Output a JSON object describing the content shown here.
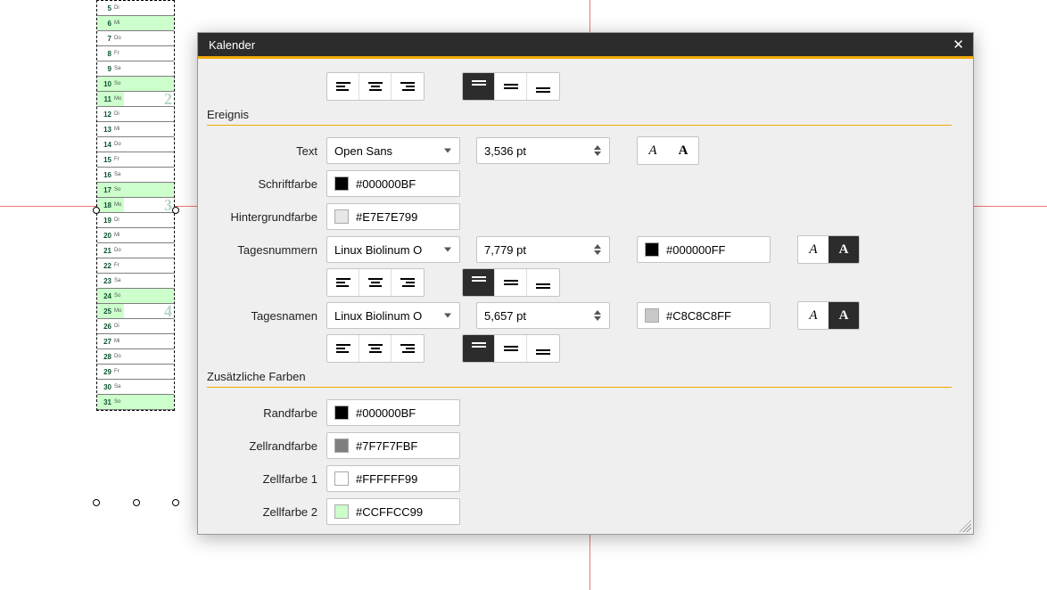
{
  "dialog": {
    "title": "Kalender"
  },
  "sections": {
    "ereignis": "Ereignis",
    "zusatz": "Zusätzliche Farben"
  },
  "labels": {
    "text": "Text",
    "schriftfarbe": "Schriftfarbe",
    "hintergrundfarbe": "Hintergrundfarbe",
    "tagesnummern": "Tagesnummern",
    "tagesnamen": "Tagesnamen",
    "randfarbe": "Randfarbe",
    "zellrandfarbe": "Zellrandfarbe",
    "zellfarbe1": "Zellfarbe 1",
    "zellfarbe2": "Zellfarbe 2"
  },
  "values": {
    "textFont": "Open Sans",
    "textSize": "3,536 pt",
    "schriftfarbe": "#000000BF",
    "hintergrundfarbe": "#E7E7E799",
    "tnFont": "Linux Biolinum O",
    "tnSize": "7,779 pt",
    "tnColor": "#000000FF",
    "tdFont": "Linux Biolinum O",
    "tdSize": "5,657 pt",
    "tdColor": "#C8C8C8FF",
    "randfarbe": "#000000BF",
    "zellrandfarbe": "#7F7F7FBF",
    "zellfarbe1": "#FFFFFF99",
    "zellfarbe2": "#CCFFCC99"
  },
  "swatches": {
    "schriftfarbe": "#000000",
    "hintergrundfarbe": "#e7e7e7",
    "tnColor": "#000000",
    "tdColor": "#c8c8c8",
    "randfarbe": "#000000",
    "zellrandfarbe": "#7f7f7f",
    "zellfarbe1": "#ffffff",
    "zellfarbe2": "#ccffcc"
  },
  "calendar_strip": [
    {
      "n": "5",
      "d": "Di"
    },
    {
      "n": "6",
      "d": "Mi",
      "w": true
    },
    {
      "n": "7",
      "d": "Do"
    },
    {
      "n": "8",
      "d": "Fr"
    },
    {
      "n": "9",
      "d": "Sa"
    },
    {
      "n": "10",
      "d": "So",
      "w": true
    },
    {
      "n": "11",
      "d": "Mo",
      "big": "2",
      "s0": true
    },
    {
      "n": "12",
      "d": "Di"
    },
    {
      "n": "13",
      "d": "Mi"
    },
    {
      "n": "14",
      "d": "Do"
    },
    {
      "n": "15",
      "d": "Fr"
    },
    {
      "n": "16",
      "d": "Sa"
    },
    {
      "n": "17",
      "d": "So",
      "w": true
    },
    {
      "n": "18",
      "d": "Mo",
      "big": "3",
      "s0": true
    },
    {
      "n": "19",
      "d": "Di"
    },
    {
      "n": "20",
      "d": "Mi"
    },
    {
      "n": "21",
      "d": "Do"
    },
    {
      "n": "22",
      "d": "Fr"
    },
    {
      "n": "23",
      "d": "Sa"
    },
    {
      "n": "24",
      "d": "So",
      "w": true
    },
    {
      "n": "25",
      "d": "Mo",
      "big": "4",
      "s0": true
    },
    {
      "n": "26",
      "d": "Di"
    },
    {
      "n": "27",
      "d": "Mi"
    },
    {
      "n": "28",
      "d": "Do"
    },
    {
      "n": "29",
      "d": "Fr"
    },
    {
      "n": "30",
      "d": "Sa"
    },
    {
      "n": "31",
      "d": "So",
      "w": true
    }
  ]
}
